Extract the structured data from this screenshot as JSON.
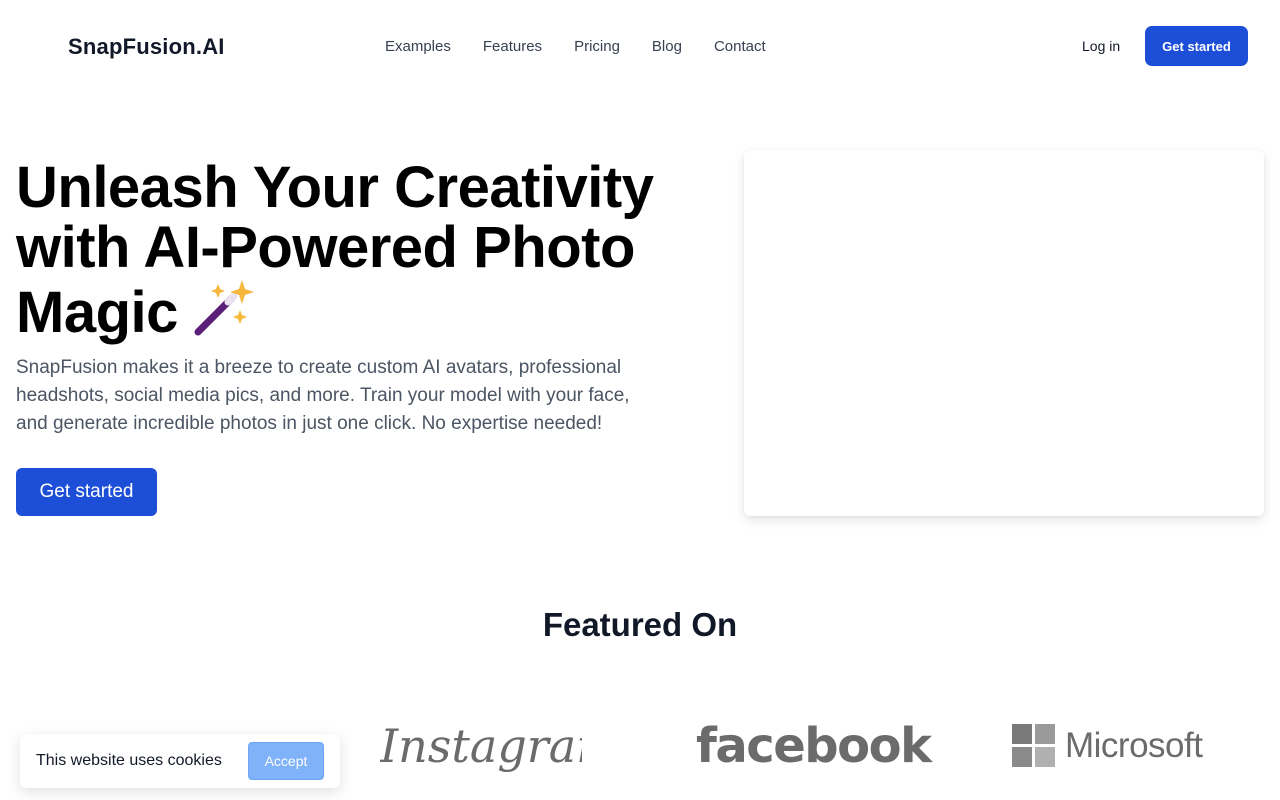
{
  "header": {
    "logo": "SnapFusion.AI",
    "nav": [
      "Examples",
      "Features",
      "Pricing",
      "Blog",
      "Contact"
    ],
    "login": "Log in",
    "cta": "Get started"
  },
  "hero": {
    "title": "Unleash Your Creativity with AI-Powered Photo Magic",
    "title_icon": "magic-wand-emoji",
    "subtitle": "SnapFusion makes it a breeze to create custom AI avatars, professional headshots, social media pics, and more. Train your model with your face, and generate incredible photos in just one click. No expertise needed!",
    "cta": "Get started"
  },
  "featured": {
    "title": "Featured On",
    "logos": [
      "Instagram",
      "facebook",
      "Microsoft"
    ]
  },
  "cookie": {
    "text": "This website uses cookies",
    "button": "Accept"
  },
  "colors": {
    "primary": "#1d4ed8",
    "cookie_button": "#7fb2f9",
    "logo_gray": "#6b6b6b"
  }
}
